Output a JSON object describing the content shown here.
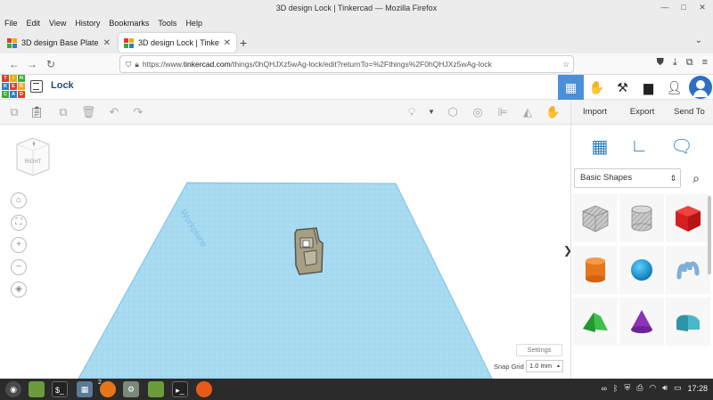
{
  "window": {
    "title": "3D design Lock | Tinkercad — Mozilla Firefox"
  },
  "menu": [
    "File",
    "Edit",
    "View",
    "History",
    "Bookmarks",
    "Tools",
    "Help"
  ],
  "tabs": [
    {
      "label": "3D design Base Plate | Tinkercad"
    },
    {
      "label": "3D design Lock | Tinkercad"
    }
  ],
  "address": {
    "url_prefix": "https://www.",
    "host": "tinkercad.com",
    "url_path": "/things/0hQHJXz5wAg-lock/edit?returnTo=%2Fthings%2F0hQHJXz5wAg-lock"
  },
  "app": {
    "logo_letters": [
      "T",
      "I",
      "N",
      "K",
      "E",
      "R",
      "C",
      "A",
      "D"
    ],
    "design_name": "Lock"
  },
  "panel": {
    "actions": [
      "Import",
      "Export",
      "Send To"
    ],
    "shape_category": "Basic Shapes",
    "shapes": [
      "box-hole",
      "cylinder-hole",
      "box",
      "cylinder",
      "sphere",
      "scribble",
      "roof",
      "cone",
      "round-roof"
    ]
  },
  "viewport": {
    "viewcube_label": "RIGHT",
    "workplane_label": "Workplane",
    "settings_label": "Settings",
    "snap_grid_label": "Snap Grid",
    "snap_grid_value": "1.0 mm"
  },
  "taskbar": {
    "clock": "17:28",
    "badge": "2"
  },
  "colors": {
    "accent": "#4a90d9",
    "grid": "#a9dcf1",
    "grid_line": "#8ccbe8",
    "lock_object": "#a79f82",
    "design_name": "#2a4a6a"
  }
}
